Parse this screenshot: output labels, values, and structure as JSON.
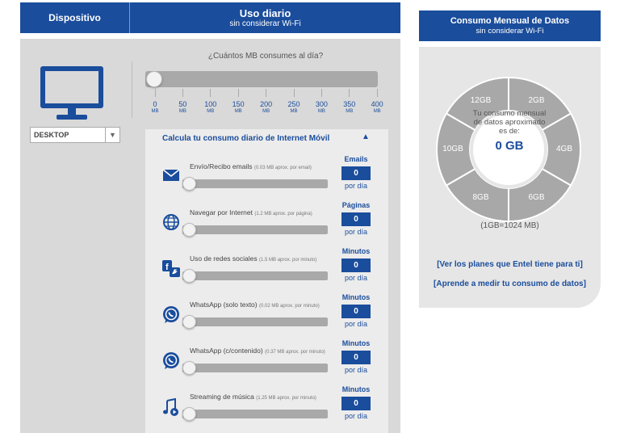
{
  "header": {
    "device_label": "Dispositivo",
    "usage_title": "Uso diario",
    "usage_subtitle": "sin considerar Wi-Fi"
  },
  "device": {
    "selected": "DESKTOP"
  },
  "question": "¿Cuántos MB consumes al día?",
  "main_slider": {
    "value": 0,
    "ticks": [
      {
        "num": "0",
        "unit": "MB"
      },
      {
        "num": "50",
        "unit": "MB"
      },
      {
        "num": "100",
        "unit": "MB"
      },
      {
        "num": "150",
        "unit": "MB"
      },
      {
        "num": "200",
        "unit": "MB"
      },
      {
        "num": "250",
        "unit": "MB"
      },
      {
        "num": "300",
        "unit": "MB"
      },
      {
        "num": "350",
        "unit": "MB"
      },
      {
        "num": "400",
        "unit": "MB"
      }
    ]
  },
  "calc": {
    "title": "Calcula tu consumo diario de Internet Móvil",
    "caret": "▲",
    "rows": [
      {
        "icon": "envelope-icon",
        "label": "Envío/Recibo emails",
        "note": "(0.03 MB aprox. por email)",
        "unit": "Emails",
        "value": "0",
        "per": "por día"
      },
      {
        "icon": "globe-icon",
        "label": "Navegar por Internet",
        "note": "(1.2 MB aprox. por página)",
        "unit": "Páginas",
        "value": "0",
        "per": "por día"
      },
      {
        "icon": "social-icon",
        "label": "Uso de redes sociales",
        "note": "(1.5 MB aprox. por minuto)",
        "unit": "Minutos",
        "value": "0",
        "per": "por día"
      },
      {
        "icon": "whatsapp-icon",
        "label": "WhatsApp (solo texto)",
        "note": "(0.02 MB aprox. por minuto)",
        "unit": "Minutos",
        "value": "0",
        "per": "por día"
      },
      {
        "icon": "whatsapp-icon",
        "label": "WhatsApp (c/contenido)",
        "note": "(0.37 MB aprox. por minuto)",
        "unit": "Minutos",
        "value": "0",
        "per": "por día"
      },
      {
        "icon": "music-icon",
        "label": "Streaming de música",
        "note": "(1.25 MB aprox. por minuto)",
        "unit": "Minutos",
        "value": "0",
        "per": "por día"
      }
    ]
  },
  "monthly": {
    "title": "Consumo Mensual de Datos",
    "subtitle": "sin considerar Wi-Fi",
    "segments": [
      "2GB",
      "4GB",
      "6GB",
      "8GB",
      "10GB",
      "12GB"
    ],
    "center_text": "Tu consumo mensual de datos aproximado es de:",
    "center_value": "0 GB",
    "equivalence": "(1GB=1024 MB)",
    "link_plans": "[Ver los planes que Entel tiene para ti]",
    "link_measure": "[Aprende a medir tu consumo de datos]"
  },
  "colors": {
    "brand": "#1a4d9c",
    "segment": "#a8a8a8"
  }
}
